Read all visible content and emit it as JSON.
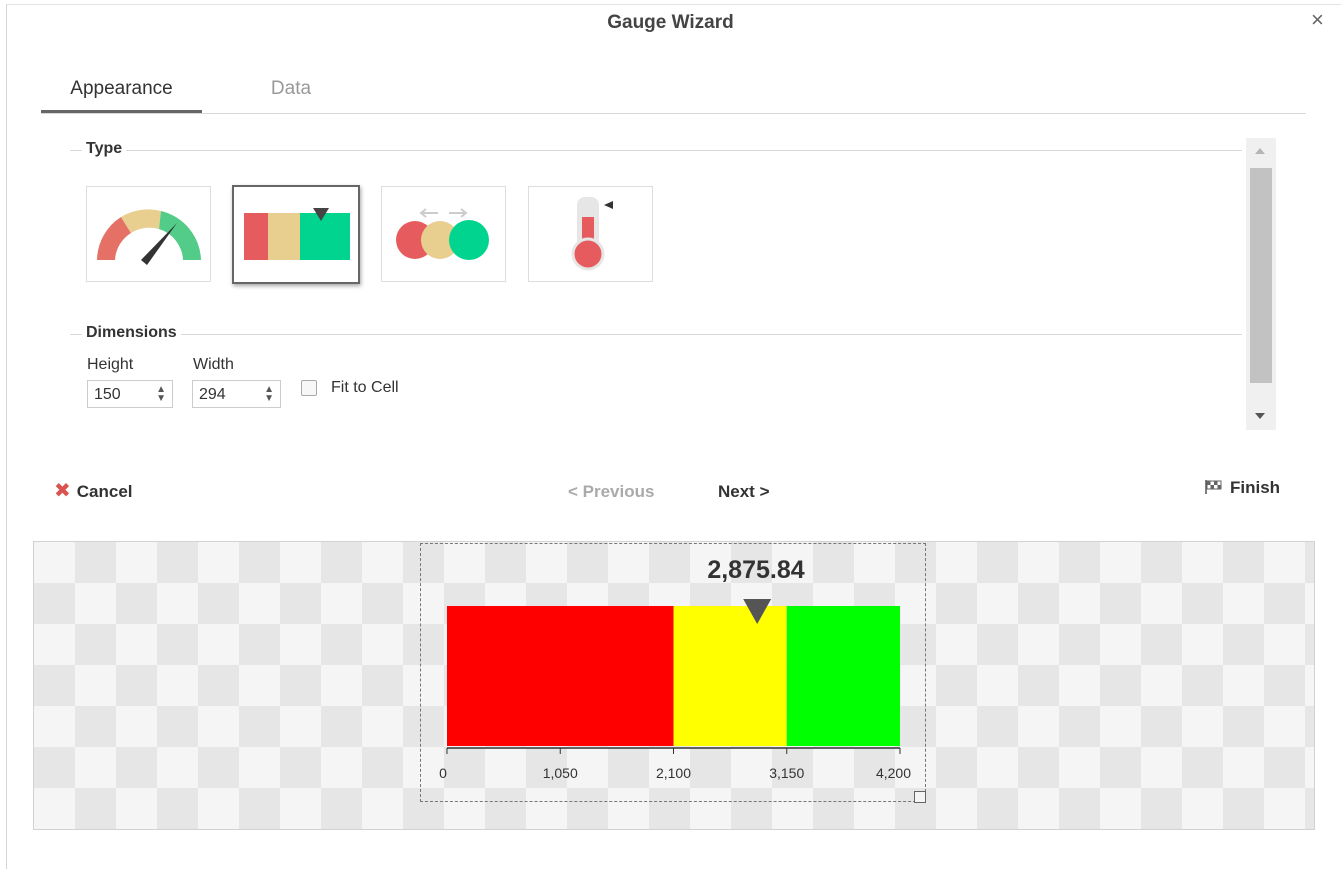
{
  "dialog": {
    "title": "Gauge Wizard",
    "close_icon": "×"
  },
  "tabs": [
    {
      "label": "Appearance",
      "active": true
    },
    {
      "label": "Data",
      "active": false
    }
  ],
  "type_section": {
    "label": "Type",
    "options": [
      {
        "name": "radial-gauge",
        "selected": false
      },
      {
        "name": "linear-bar-gauge",
        "selected": true
      },
      {
        "name": "traffic-light-gauge",
        "selected": false
      },
      {
        "name": "thermometer-gauge",
        "selected": false
      }
    ]
  },
  "dimensions": {
    "label": "Dimensions",
    "height_label": "Height",
    "height_value": "150",
    "width_label": "Width",
    "width_value": "294",
    "fit_to_cell_label": "Fit to Cell",
    "fit_to_cell_checked": false
  },
  "footer": {
    "cancel_label": "Cancel",
    "previous_label": "< Previous",
    "next_label": "Next >",
    "finish_label": "Finish"
  },
  "colors": {
    "red": "#ff0000",
    "yellow": "#ffff00",
    "green": "#00ff00",
    "marker": "#555555"
  },
  "chart_data": {
    "type": "bar",
    "value_label": "2,875.84",
    "value": 2875.84,
    "min": 0,
    "max": 4200,
    "bands": [
      {
        "from": 0,
        "to": 2100,
        "color": "#ff0000"
      },
      {
        "from": 2100,
        "to": 3150,
        "color": "#ffff00"
      },
      {
        "from": 3150,
        "to": 4200,
        "color": "#00ff00"
      }
    ],
    "ticks": [
      0,
      1050,
      2100,
      3150,
      4200
    ],
    "tick_labels": [
      "0",
      "1,050",
      "2,100",
      "3,150",
      "4,200"
    ]
  }
}
